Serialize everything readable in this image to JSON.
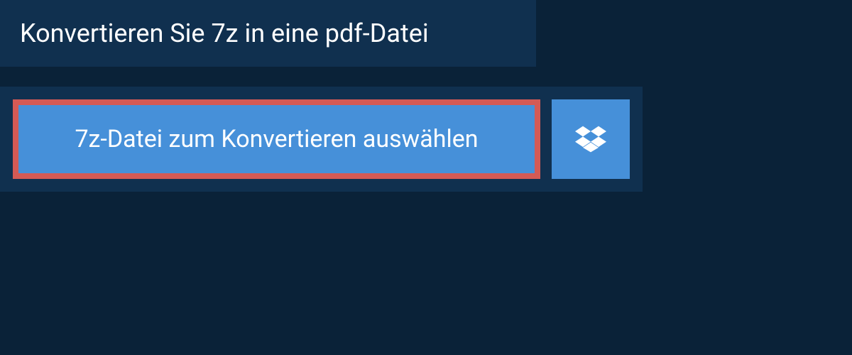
{
  "header": {
    "title": "Konvertieren Sie 7z in eine pdf-Datei"
  },
  "upload": {
    "select_label": "7z-Datei zum Konvertieren auswählen",
    "dropbox_icon": "dropbox"
  },
  "colors": {
    "background": "#0a2238",
    "panel": "#10304f",
    "button_primary": "#4690d9",
    "highlight_border": "#d45a55",
    "text": "#ffffff"
  }
}
